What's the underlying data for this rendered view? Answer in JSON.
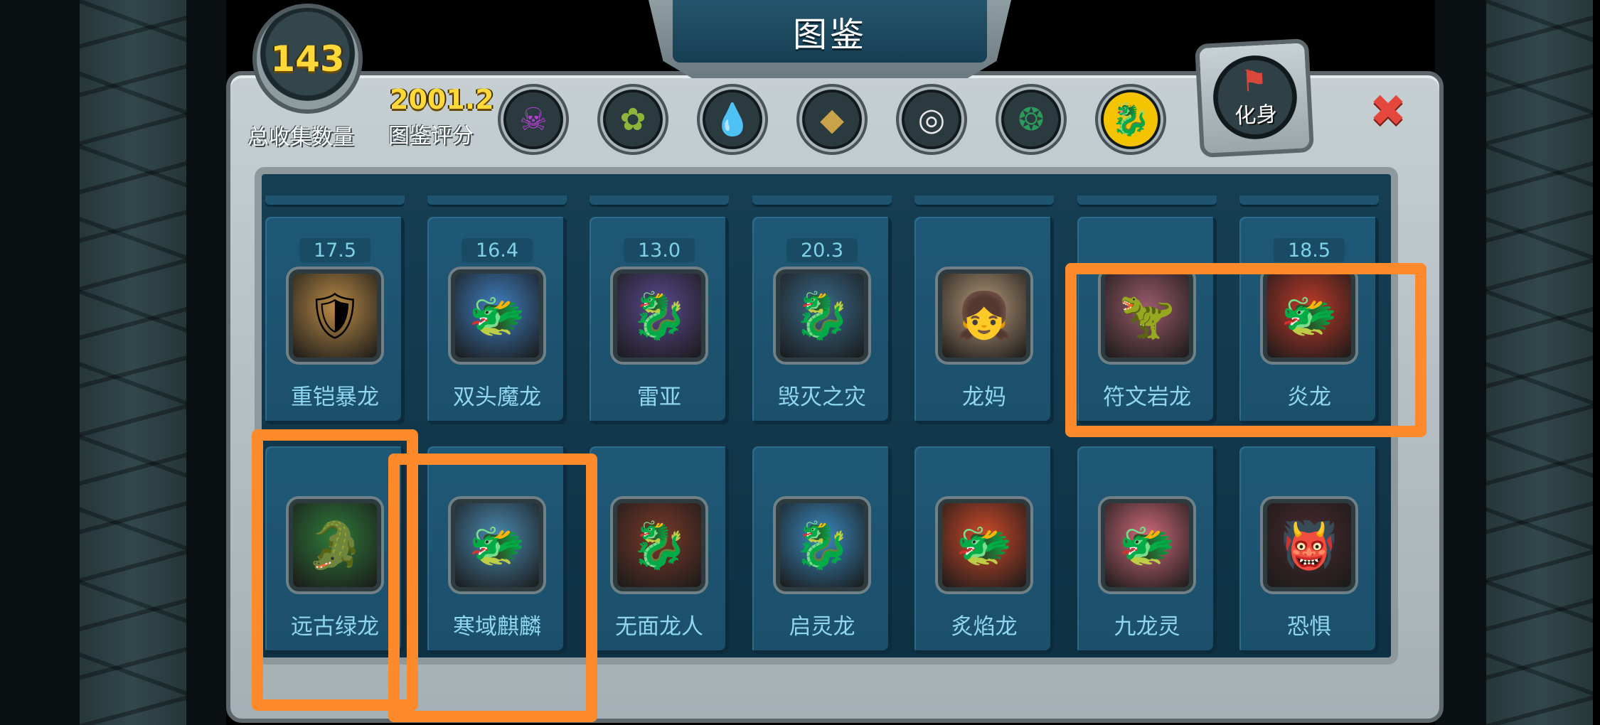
{
  "title": "图鉴",
  "stats": {
    "collected_count": "143",
    "collected_label": "总收集数量",
    "score_value": "2001.2",
    "score_label": "图鉴评分"
  },
  "element_filters": [
    {
      "icon": "skull-element-icon",
      "glyph": "☠",
      "color": "#b143d1"
    },
    {
      "icon": "nature-element-icon",
      "glyph": "✿",
      "color": "#8fb43a"
    },
    {
      "icon": "water-element-icon",
      "glyph": "💧",
      "color": "#2f7fd1"
    },
    {
      "icon": "rock-element-icon",
      "glyph": "◆",
      "color": "#c9a24a"
    },
    {
      "icon": "light-element-icon",
      "glyph": "◎",
      "color": "#e8e8e8"
    },
    {
      "icon": "wind-element-icon",
      "glyph": "❂",
      "color": "#2e9a5a"
    },
    {
      "icon": "dragon-element-icon",
      "glyph": "🐉",
      "color": "#c0202a"
    }
  ],
  "avatar_button": {
    "label": "化身",
    "glyph": "⚑"
  },
  "close_glyph": "✖",
  "cards": [
    {
      "name": "重铠暴龙",
      "score": "17.5",
      "glyph": "🛡",
      "bg": "#b98a46"
    },
    {
      "name": "双头魔龙",
      "score": "16.4",
      "glyph": "🐲",
      "bg": "#3f7fc0"
    },
    {
      "name": "雷亚",
      "score": "13.0",
      "glyph": "🐉",
      "bg": "#5a4a8e"
    },
    {
      "name": "毁灭之灾",
      "score": "20.3",
      "glyph": "🐉",
      "bg": "#3a6a8a"
    },
    {
      "name": "龙妈",
      "score": "",
      "glyph": "👧",
      "bg": "#b89a7a"
    },
    {
      "name": "符文岩龙",
      "score": "",
      "glyph": "🦖",
      "bg": "#9a5a6a"
    },
    {
      "name": "炎龙",
      "score": "18.5",
      "glyph": "🐲",
      "bg": "#c03a2a"
    },
    {
      "name": "远古绿龙",
      "score": "",
      "glyph": "🐊",
      "bg": "#2f7a3a"
    },
    {
      "name": "寒域麒麟",
      "score": "",
      "glyph": "🐲",
      "bg": "#4a8ab0"
    },
    {
      "name": "无面龙人",
      "score": "",
      "glyph": "🐉",
      "bg": "#7a3a2a"
    },
    {
      "name": "启灵龙",
      "score": "",
      "glyph": "🐉",
      "bg": "#3a8ac0"
    },
    {
      "name": "炙焰龙",
      "score": "",
      "glyph": "🐲",
      "bg": "#d04a2a"
    },
    {
      "name": "九龙灵",
      "score": "",
      "glyph": "🐲",
      "bg": "#d06a7a"
    },
    {
      "name": "恐惧",
      "score": "",
      "glyph": "👹",
      "bg": "#4a2a2e"
    }
  ],
  "colors": {
    "highlight": "#ff8a2b",
    "name_text": "#8fd6ee",
    "gold": "#ffd83a"
  }
}
